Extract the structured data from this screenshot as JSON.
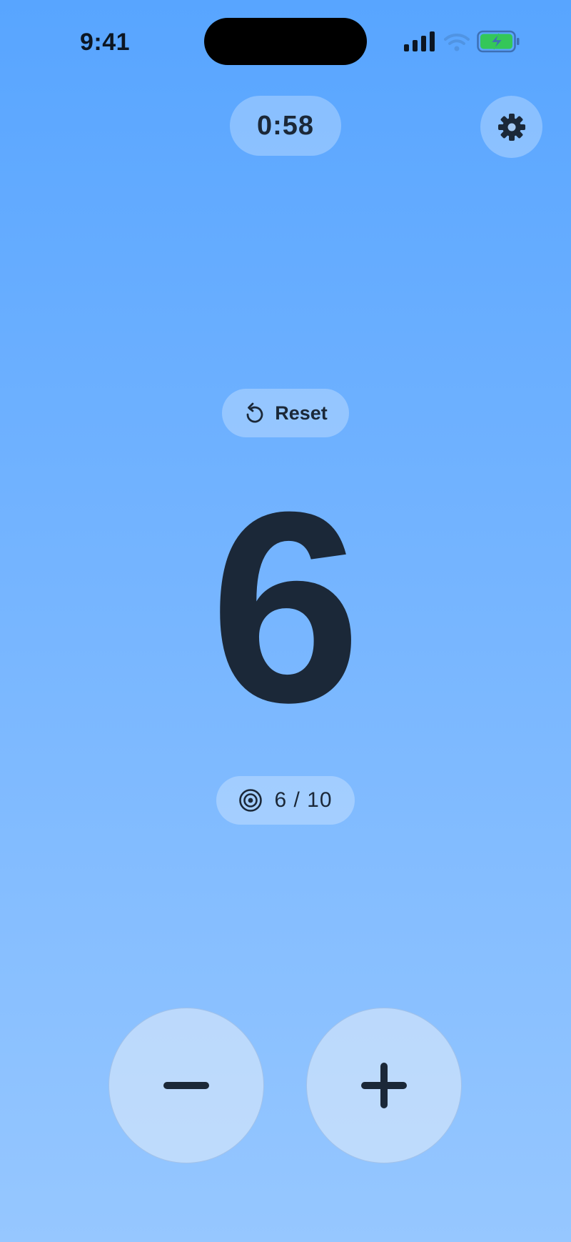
{
  "status_bar": {
    "time": "9:41",
    "icons": [
      "signal-icon",
      "wifi-icon",
      "battery-charging-icon"
    ]
  },
  "timer": {
    "value": "0:58"
  },
  "settings": {
    "icon": "gear-icon"
  },
  "reset": {
    "label": "Reset",
    "icon": "reset-arrow-icon"
  },
  "counter": {
    "value": "6"
  },
  "goal": {
    "label": "6 / 10",
    "icon": "target-icon"
  },
  "controls": {
    "decrement_icon": "minus-icon",
    "increment_icon": "plus-icon"
  },
  "colors": {
    "background_top": "#58a5ff",
    "background_bottom": "#96c7ff",
    "text": "#1b2838",
    "battery_fill": "#34c759"
  }
}
